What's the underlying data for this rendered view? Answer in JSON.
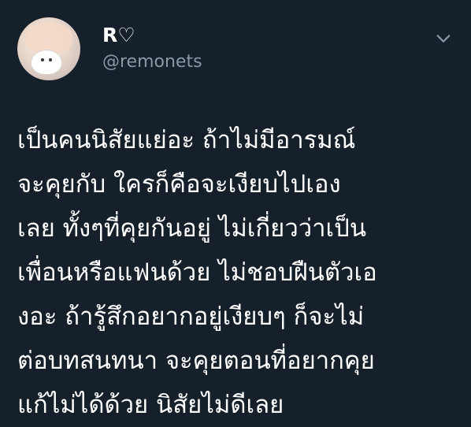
{
  "user": {
    "display_name": "R♡",
    "handle": "@remonets"
  },
  "icons": {
    "menu": "chevron-down-icon",
    "avatar": "avatar"
  },
  "colors": {
    "background": "#15202b",
    "text_primary": "#ffffff",
    "text_secondary": "#8899a6"
  },
  "tweet": {
    "lines": [
      "เป็นคนนิสัยแย่อะ ถ้าไม่มีอารมณ์",
      "จะคุยกับ ใครก็คือจะเงียบไปเอง",
      "เลย ทั้งๆที่คุยกันอยู่ ไม่เกี่ยวว่าเป็น",
      "เพื่อนหรือแฟนด้วย ไม่ชอบฝืนตัวเอ",
      "งอะ ถ้ารู้สึกอยากอยู่เงียบๆ ก็จะไม่",
      "ต่อบทสนทนา จะคุยตอนที่อยากคุย",
      "แก้ไม่ได้ด้วย นิสัยไม่ดีเลย"
    ]
  }
}
